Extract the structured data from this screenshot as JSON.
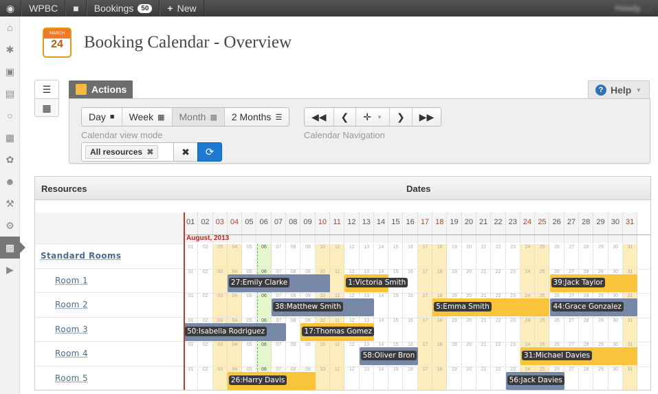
{
  "adminbar": {
    "site": "WPBC",
    "bookings_label": "Bookings",
    "bookings_count": "50",
    "new_label": "New",
    "user": "Howdy, ..."
  },
  "page": {
    "title": "Booking Calendar - Overview",
    "logo_month": "MARCH",
    "logo_day": "24"
  },
  "tabs": {
    "actions": "Actions",
    "help": "Help"
  },
  "views": {
    "day": "Day",
    "week": "Week",
    "month": "Month",
    "two_months": "2 Months",
    "label": "Calendar view mode"
  },
  "navigation": {
    "label": "Calendar Navigation"
  },
  "resources_filter": {
    "chip": "All resources"
  },
  "grid": {
    "resources_header": "Resources",
    "dates_header": "Dates",
    "month_label": "August, 2013",
    "days": [
      "01",
      "02",
      "03",
      "04",
      "05",
      "06",
      "07",
      "08",
      "09",
      "10",
      "11",
      "12",
      "13",
      "14",
      "15",
      "16",
      "17",
      "18",
      "19",
      "20",
      "21",
      "22",
      "23",
      "24",
      "25",
      "26",
      "27",
      "28",
      "29",
      "30",
      "31"
    ],
    "weekend_days": [
      3,
      4,
      10,
      11,
      17,
      18,
      24,
      25,
      31
    ],
    "today_day": 6,
    "rows": [
      {
        "label": "Standard Rooms",
        "type": "group"
      },
      {
        "label": "Room 1",
        "type": "room"
      },
      {
        "label": "Room 2",
        "type": "room"
      },
      {
        "label": "Room 3",
        "type": "room"
      },
      {
        "label": "Room 4",
        "type": "room"
      },
      {
        "label": "Room 5",
        "type": "room"
      }
    ],
    "bookings": [
      {
        "row": 1,
        "start": 4,
        "end": 10,
        "color": "grey",
        "label": "27:Emily Clarke"
      },
      {
        "row": 1,
        "start": 12,
        "end": 14,
        "color": "yel",
        "label": "1:Victoria Smith"
      },
      {
        "row": 1,
        "start": 26,
        "end": 31,
        "color": "yel",
        "label": "39:Jack Taylor"
      },
      {
        "row": 2,
        "start": 7,
        "end": 13,
        "color": "grey",
        "label": "38:Matthew Smith"
      },
      {
        "row": 2,
        "start": 18,
        "end": 25,
        "color": "yel",
        "label": "5:Emma Smith"
      },
      {
        "row": 2,
        "start": 26,
        "end": 31,
        "color": "grey",
        "label": "44:Grace Gonzalez"
      },
      {
        "row": 3,
        "start": 1,
        "end": 7,
        "color": "grey",
        "label": "50:Isabella Rodriguez"
      },
      {
        "row": 3,
        "start": 9,
        "end": 13,
        "color": "yel",
        "label": "17:Thomas Gomez"
      },
      {
        "row": 4,
        "start": 13,
        "end": 16,
        "color": "grey",
        "label": "58:Oliver Bron"
      },
      {
        "row": 4,
        "start": 24,
        "end": 31,
        "color": "yel",
        "label": "31:Michael Davies"
      },
      {
        "row": 5,
        "start": 4,
        "end": 9,
        "color": "yel",
        "label": "26:Harry Davis"
      },
      {
        "row": 5,
        "start": 23,
        "end": 26,
        "color": "grey",
        "label": "56:Jack Davies"
      }
    ]
  }
}
